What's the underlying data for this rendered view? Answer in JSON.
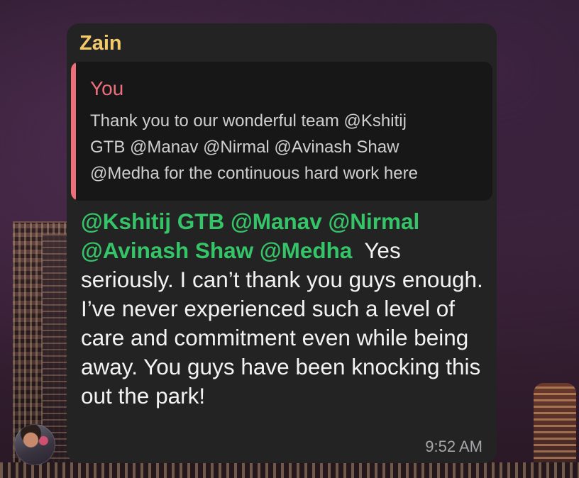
{
  "message": {
    "sender": "Zain",
    "colors": {
      "sender": "#f3c96a",
      "reply_accent": "#ee6f7c",
      "mention": "#35c468",
      "bubble": "#232324",
      "reply_bg": "#171718"
    },
    "reply": {
      "author": "You",
      "text_lines": [
        "Thank you to our wonderful team @Kshitij",
        "GTB @Manav @Nirmal @Avinash Shaw",
        "@Medha for the continuous hard work here"
      ]
    },
    "mentions": [
      "@Kshitij GTB",
      "@Manav",
      "@Nirmal",
      "@Avinash Shaw",
      "@Medha"
    ],
    "body_text": "Yes seriously. I can’t thank you guys enough. I’ve never experienced such a level of care and commitment even while being away. You guys have been knocking this out the park!",
    "time": "9:52 AM"
  },
  "avatar": {
    "icon": "user-avatar"
  }
}
